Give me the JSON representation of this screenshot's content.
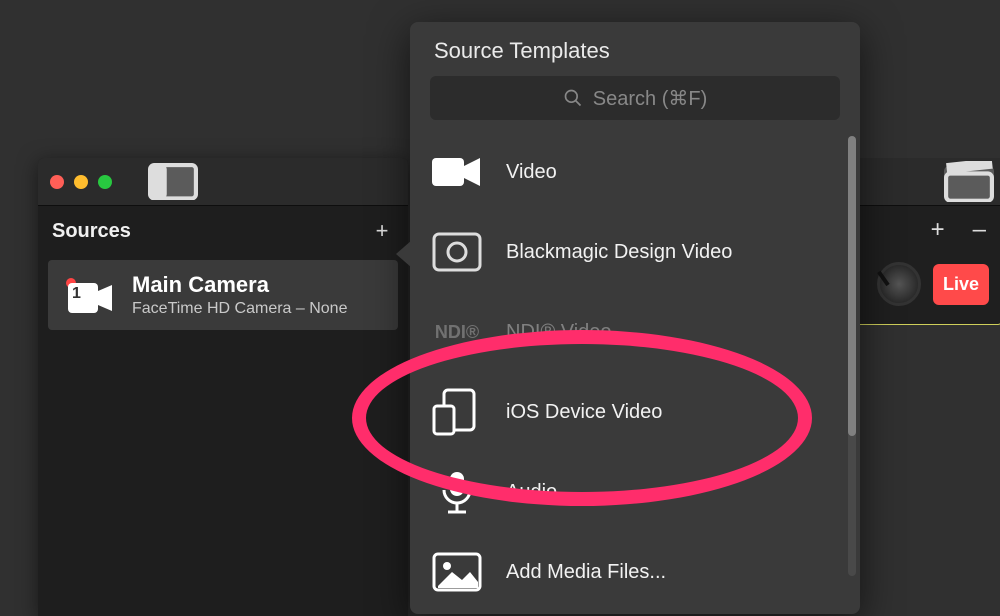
{
  "left_window": {
    "sources_label": "Sources",
    "main_source": {
      "title": "Main Camera",
      "subtitle": "FaceTime HD Camera – None",
      "badge": "1"
    }
  },
  "right_panel": {
    "live_label": "Live"
  },
  "popover": {
    "title": "Source Templates",
    "search_placeholder": "Search (⌘F)",
    "templates": {
      "video": "Video",
      "blackmagic": "Blackmagic Design Video",
      "ndi_brand": "NDI®",
      "ndi": "NDI® Video",
      "ios": "iOS Device Video",
      "audio": "Audio",
      "media": "Add Media Files..."
    }
  },
  "colors": {
    "traffic_red": "#ff5f57",
    "traffic_yellow": "#ffbd2e",
    "traffic_green": "#28c840"
  }
}
